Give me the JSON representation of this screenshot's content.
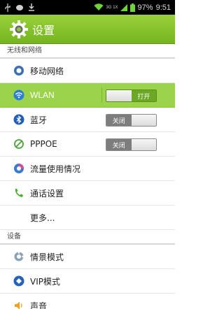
{
  "status_bar": {
    "network_label": "3G 1X",
    "battery_text": "97%",
    "time": "9:51"
  },
  "action_bar": {
    "title": "设置"
  },
  "sections": {
    "wireless_header": "无线和网络",
    "device_header": "设备"
  },
  "items": {
    "mobile_network": "移动网络",
    "wlan": "WLAN",
    "wlan_toggle": "打开",
    "bluetooth": "蓝牙",
    "bluetooth_toggle": "关闭",
    "pppoe": "PPPOE",
    "pppoe_toggle": "关闭",
    "data_usage": "流量使用情况",
    "call_settings": "通话设置",
    "more": "更多...",
    "scene_mode": "情景模式",
    "vip_mode": "VIP模式",
    "sound": "声音"
  },
  "colors": {
    "accent": "#8cc63f",
    "highlight_row": "#9bd44b",
    "status_bar_bg": "#000000"
  }
}
